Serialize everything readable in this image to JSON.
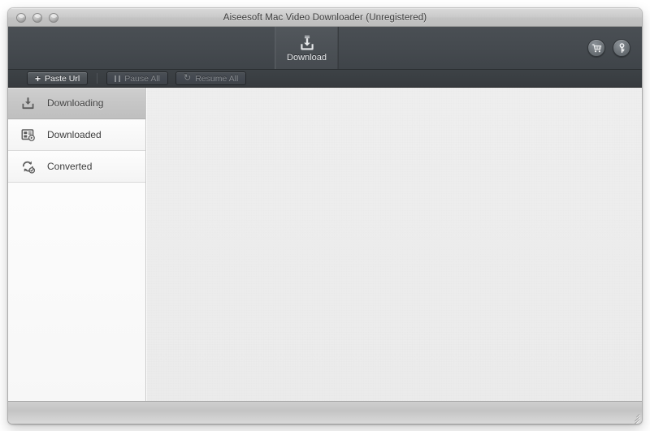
{
  "window": {
    "title": "Aiseesoft Mac Video Downloader (Unregistered)",
    "traffic_lights": [
      {
        "name": "close-button",
        "label": "Close"
      },
      {
        "name": "minimize-button",
        "label": "Minimize"
      },
      {
        "name": "zoom-button",
        "label": "Zoom"
      }
    ]
  },
  "toolbar": {
    "tabs": [
      {
        "label": "Download",
        "icon": "download-tray-icon",
        "selected": true
      }
    ],
    "right_buttons": [
      {
        "name": "buy-button",
        "icon": "shopping-cart-icon",
        "label": "Buy"
      },
      {
        "name": "register-button",
        "icon": "key-icon",
        "label": "Register"
      }
    ]
  },
  "actionbar": {
    "buttons": [
      {
        "label": "Paste Url",
        "icon": "plus-icon",
        "enabled": true
      },
      {
        "label": "Pause All",
        "icon": "pause-icon",
        "enabled": false
      },
      {
        "label": "Resume All",
        "icon": "refresh-icon",
        "enabled": false
      }
    ]
  },
  "sidebar": {
    "items": [
      {
        "label": "Downloading",
        "icon": "download-tray-icon",
        "selected": true
      },
      {
        "label": "Downloaded",
        "icon": "media-file-icon",
        "selected": false
      },
      {
        "label": "Converted",
        "icon": "convert-arrows-icon",
        "selected": false
      }
    ]
  },
  "content": {
    "items": [],
    "empty_message": ""
  },
  "statusbar": {
    "text": ""
  },
  "colors": {
    "toolbar_dark": "#474c51",
    "actionbar_dark": "#3a3f43",
    "titlebar_gray": "#c8c8c8",
    "sidebar_selected": "#c6c6c6",
    "content_gray": "#ededed",
    "text_light": "#e3e5e7",
    "text_dark": "#3b3b3b",
    "text_disabled": "#85898d"
  }
}
